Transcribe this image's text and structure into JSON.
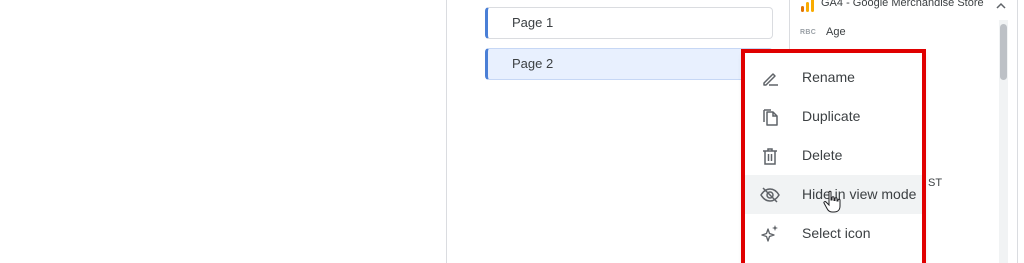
{
  "pages": [
    {
      "label": "Page 1",
      "selected": false
    },
    {
      "label": "Page 2",
      "selected": true
    }
  ],
  "data_source": {
    "name": "GA4 - Google Merchandise Store",
    "fields": [
      {
        "type": "RBC",
        "name": "Age"
      }
    ],
    "partial_text": "ST"
  },
  "context_menu": {
    "items": [
      {
        "label": "Rename",
        "icon": "rename-icon"
      },
      {
        "label": "Duplicate",
        "icon": "duplicate-icon"
      },
      {
        "label": "Delete",
        "icon": "delete-icon"
      },
      {
        "label": "Hide in view mode",
        "icon": "eye-off-icon"
      },
      {
        "label": "Select icon",
        "icon": "sparkle-icon"
      }
    ]
  },
  "colors": {
    "highlight": "#e00000",
    "page_accent": "#4a7fd6",
    "selected_bg": "#e8f0fe",
    "ga_orange": "#f9ab00",
    "ga_dark_orange": "#e37400"
  }
}
